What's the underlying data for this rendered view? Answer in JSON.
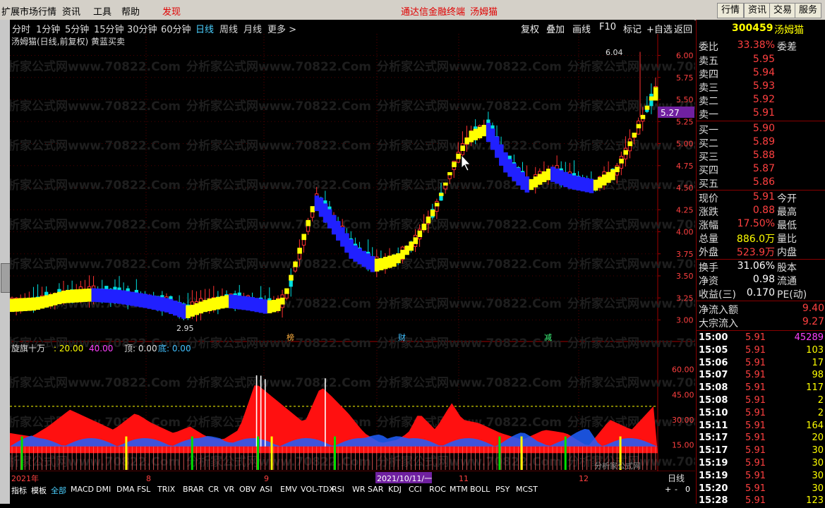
{
  "menubar": {
    "items": [
      "扩展市场行情",
      "资讯",
      "工具",
      "帮助"
    ],
    "discover": "发现",
    "center_title": "通达信金融终端",
    "stock_title": "汤姆猫",
    "right_buttons": [
      "行情",
      "资讯",
      "交易",
      "服务"
    ]
  },
  "periods": [
    "分时",
    "1分钟",
    "5分钟",
    "15分钟",
    "30分钟",
    "60分钟",
    "日线",
    "周线",
    "月线",
    "更多 >"
  ],
  "selected_period": "日线",
  "toolbar_right": [
    "复权",
    "叠加",
    "画线",
    "F10",
    "标记",
    "+自选",
    "返回"
  ],
  "main_chart": {
    "title": "汤姆猫(日线,前复权) 黄蓝买卖",
    "high_label": "6.04",
    "low_label": "2.95",
    "current_price_tag": "5.27",
    "y_ticks": [
      "6.00",
      "5.75",
      "5.50",
      "5.25",
      "5.00",
      "4.75",
      "4.50",
      "4.25",
      "4.00",
      "3.75",
      "3.50",
      "3.25",
      "3.00"
    ],
    "markers": [
      "榜",
      "财",
      "减"
    ],
    "watermark": "分析家公式网www.70822.Com"
  },
  "sub_chart": {
    "title": "旋旗十万",
    "v1": ": 20.00",
    "v2": "40.00",
    "top_label": "顶: 0.00",
    "bottom_label": "底: 0.00",
    "y_ticks": [
      "60.00",
      "45.00",
      "30.00",
      "15.00"
    ],
    "brand_watermark": "分析家公式网"
  },
  "time_axis": {
    "labels": [
      "2021年",
      "8",
      "9",
      "2021/10/11/一",
      "11",
      "12"
    ],
    "right_label": "日线"
  },
  "indicator_bar": [
    "指标",
    "模板",
    "全部",
    "MACD",
    "DMI",
    "DMA",
    "FSL",
    "TRIX",
    "BRAR",
    "CR",
    "VR",
    "OBV",
    "ASI",
    "EMV",
    "VOL-TDX",
    "RSI",
    "WR",
    "SAR",
    "KDJ",
    "CCI",
    "ROC",
    "MTM",
    "BOLL",
    "PSY",
    "MCST"
  ],
  "indicator_selected": "全部",
  "zoom_buttons": [
    "+",
    "-",
    "0"
  ],
  "quote": {
    "code": "300459",
    "name": "汤姆猫",
    "weibi_label": "委比",
    "weibi_value": "33.38%",
    "weicha_label": "委差",
    "sells": [
      {
        "label": "卖五",
        "price": "5.95"
      },
      {
        "label": "卖四",
        "price": "5.94"
      },
      {
        "label": "卖三",
        "price": "5.93"
      },
      {
        "label": "卖二",
        "price": "5.92"
      },
      {
        "label": "卖一",
        "price": "5.91"
      }
    ],
    "buys": [
      {
        "label": "买一",
        "price": "5.90"
      },
      {
        "label": "买二",
        "price": "5.89"
      },
      {
        "label": "买三",
        "price": "5.88"
      },
      {
        "label": "买四",
        "price": "5.87"
      },
      {
        "label": "买五",
        "price": "5.86"
      }
    ],
    "stats": [
      {
        "l1": "现价",
        "v": "5.91",
        "c": "red",
        "l2": "今开"
      },
      {
        "l1": "涨跌",
        "v": "0.88",
        "c": "red",
        "l2": "最高"
      },
      {
        "l1": "涨幅",
        "v": "17.50%",
        "c": "red",
        "l2": "最低"
      },
      {
        "l1": "总量",
        "v": "886.0万",
        "c": "yellow",
        "l2": "量比"
      },
      {
        "l1": "外盘",
        "v": "523.9万",
        "c": "red",
        "l2": "内盘"
      }
    ],
    "stats2": [
      {
        "l1": "换手",
        "v": "31.06%",
        "c": "white",
        "l2": "股本"
      },
      {
        "l1": "净资",
        "v": "0.98",
        "c": "white",
        "l2": "流通"
      },
      {
        "l1": "收益(三)",
        "v": "0.170",
        "c": "white",
        "l2": "PE(动)"
      }
    ],
    "flow": [
      {
        "label": "净流入额",
        "value": "9.40"
      },
      {
        "label": "大宗流入",
        "value": "9.27"
      }
    ],
    "ticks": [
      {
        "t": "15:00",
        "p": "5.91",
        "v": "45289",
        "c": "magenta"
      },
      {
        "t": "15:05",
        "p": "5.91",
        "v": "103",
        "c": "yellow"
      },
      {
        "t": "15:06",
        "p": "5.91",
        "v": "17",
        "c": "yellow"
      },
      {
        "t": "15:07",
        "p": "5.91",
        "v": "98",
        "c": "yellow"
      },
      {
        "t": "15:08",
        "p": "5.91",
        "v": "117",
        "c": "yellow"
      },
      {
        "t": "15:08",
        "p": "5.91",
        "v": "2",
        "c": "yellow"
      },
      {
        "t": "15:10",
        "p": "5.91",
        "v": "2",
        "c": "yellow"
      },
      {
        "t": "15:11",
        "p": "5.91",
        "v": "164",
        "c": "yellow"
      },
      {
        "t": "15:17",
        "p": "5.91",
        "v": "20",
        "c": "yellow"
      },
      {
        "t": "15:17",
        "p": "5.91",
        "v": "30",
        "c": "yellow"
      },
      {
        "t": "15:19",
        "p": "5.91",
        "v": "30",
        "c": "yellow"
      },
      {
        "t": "15:19",
        "p": "5.91",
        "v": "30",
        "c": "yellow"
      },
      {
        "t": "15:20",
        "p": "5.91",
        "v": "30",
        "c": "yellow"
      },
      {
        "t": "15:28",
        "p": "5.91",
        "v": "123",
        "c": "yellow"
      }
    ]
  },
  "chart_data": {
    "type": "candlestick",
    "ylim": [
      2.9,
      6.1
    ],
    "indicator_ylim": [
      0,
      70
    ],
    "indicator_threshold": 38
  }
}
